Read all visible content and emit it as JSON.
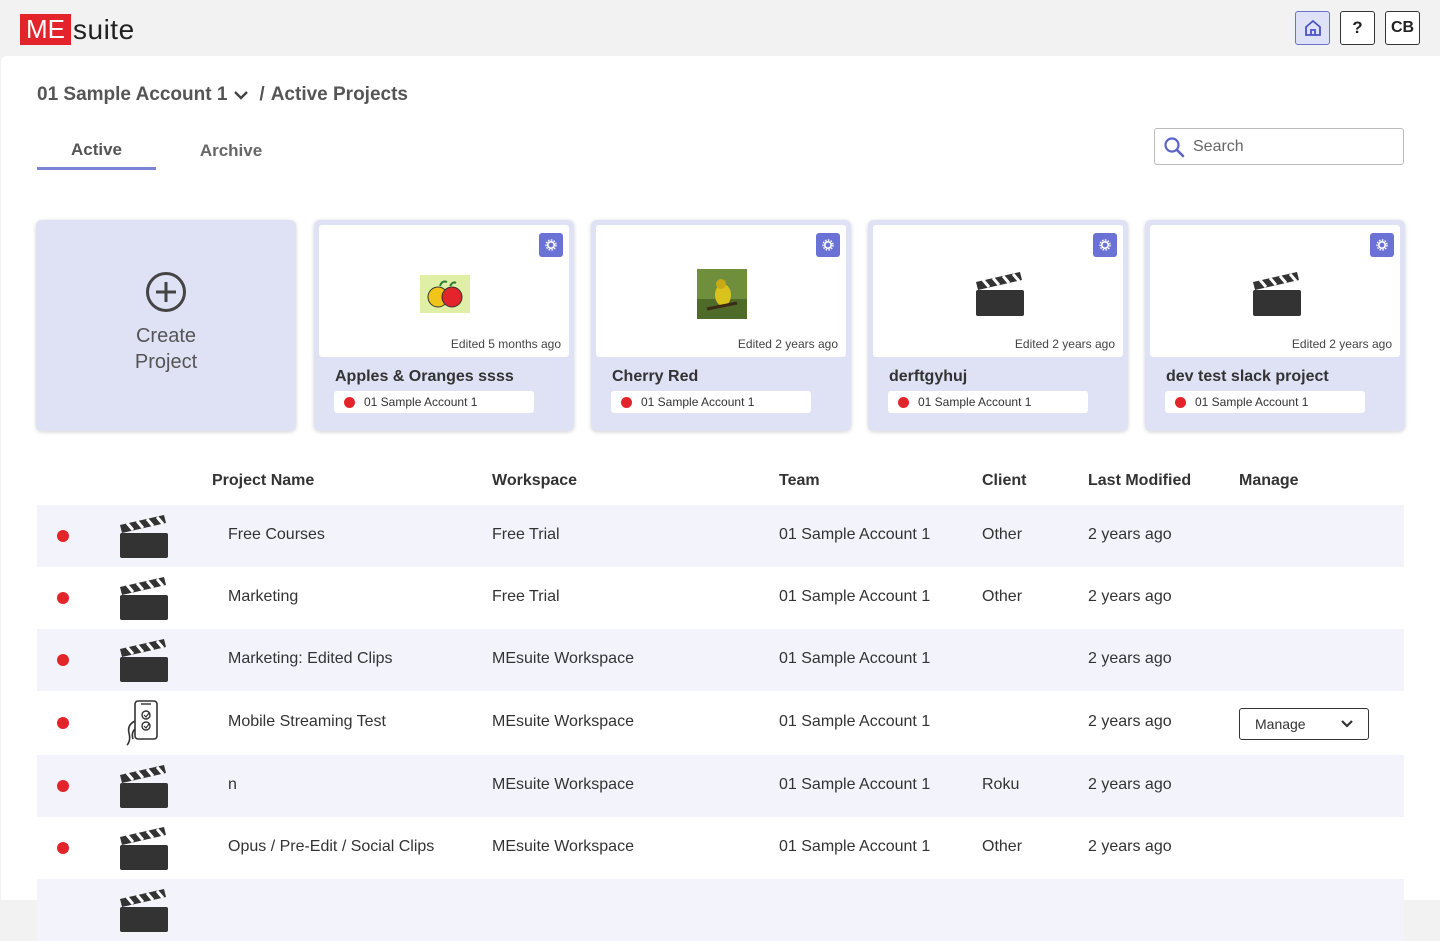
{
  "brand": {
    "me": "ME",
    "suite": "suite"
  },
  "topbar": {
    "help_label": "?",
    "user_initials": "CB"
  },
  "breadcrumb": {
    "account": "01 Sample Account 1",
    "separator": "/",
    "page": "Active Projects"
  },
  "tabs": [
    {
      "label": "Active",
      "active": true
    },
    {
      "label": "Archive",
      "active": false
    }
  ],
  "search": {
    "placeholder": "Search"
  },
  "create_card": {
    "label": "Create Project"
  },
  "cards": [
    {
      "name": "Apples & Oranges ssss",
      "edited": "Edited 5 months ago",
      "account": "01 Sample Account 1",
      "thumb": "apples-image"
    },
    {
      "name": "Cherry Red",
      "edited": "Edited 2 years ago",
      "account": "01 Sample Account 1",
      "thumb": "bird-image"
    },
    {
      "name": "derftgyhuj",
      "edited": "Edited 2 years ago",
      "account": "01 Sample Account 1",
      "thumb": "clapperboard-icon"
    },
    {
      "name": "dev test slack project",
      "edited": "Edited 2 years ago",
      "account": "01 Sample Account 1",
      "thumb": "clapperboard-icon"
    }
  ],
  "table": {
    "columns": [
      "Project Name",
      "Workspace",
      "Team",
      "Client",
      "Last Modified",
      "Manage"
    ],
    "rows": [
      {
        "name": "Free Courses",
        "workspace": "Free Trial",
        "team": "01 Sample Account 1",
        "client": "Other",
        "modified": "2 years ago",
        "icon": "clapperboard-icon"
      },
      {
        "name": "Marketing",
        "workspace": "Free Trial",
        "team": "01 Sample Account 1",
        "client": "Other",
        "modified": "2 years ago",
        "icon": "clapperboard-icon"
      },
      {
        "name": "Marketing: Edited Clips",
        "workspace": "MEsuite Workspace",
        "team": "01 Sample Account 1",
        "client": "",
        "modified": "2 years ago",
        "icon": "clapperboard-icon"
      },
      {
        "name": "Mobile Streaming Test",
        "workspace": "MEsuite Workspace",
        "team": "01 Sample Account 1",
        "client": "",
        "modified": "2 years ago",
        "icon": "mobile-hand-icon",
        "manage": "Manage"
      },
      {
        "name": "n",
        "workspace": "MEsuite Workspace",
        "team": "01 Sample Account 1",
        "client": "Roku",
        "modified": "2 years ago",
        "icon": "clapperboard-icon"
      },
      {
        "name": "Opus / Pre-Edit / Social Clips",
        "workspace": "MEsuite Workspace",
        "team": "01 Sample Account 1",
        "client": "Other",
        "modified": "2 years ago",
        "icon": "clapperboard-icon"
      }
    ]
  },
  "colors": {
    "brand_red": "#e3242b",
    "accent": "#6b72d6",
    "card_bg": "#dfe1f5",
    "status_red": "#e3242b"
  }
}
